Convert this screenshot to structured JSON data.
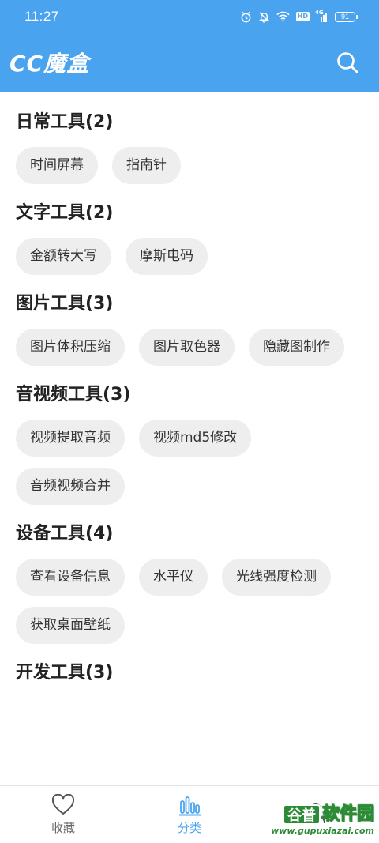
{
  "status_bar": {
    "time": "11:27",
    "network": "4G",
    "hd": "HD",
    "battery": "91"
  },
  "header": {
    "title": "CC魔盒",
    "search_icon": "search-icon"
  },
  "sections": [
    {
      "title": "日常工具(2)",
      "items": [
        "时间屏幕",
        "指南针"
      ]
    },
    {
      "title": "文字工具(2)",
      "items": [
        "金额转大写",
        "摩斯电码"
      ]
    },
    {
      "title": "图片工具(3)",
      "items": [
        "图片体积压缩",
        "图片取色器",
        "隐藏图制作"
      ]
    },
    {
      "title": "音视频工具(3)",
      "items": [
        "视频提取音频",
        "视频md5修改",
        "音频视频合并"
      ]
    },
    {
      "title": "设备工具(4)",
      "items": [
        "查看设备信息",
        "水平仪",
        "光线强度检测",
        "获取桌面壁纸"
      ]
    },
    {
      "title": "开发工具(3)",
      "items": []
    }
  ],
  "bottom_nav": {
    "items": [
      {
        "label": "收藏",
        "icon": "heart-icon"
      },
      {
        "label": "分类",
        "icon": "bar-chart-icon",
        "active": true
      },
      {
        "label": "",
        "icon": "person-icon"
      }
    ]
  },
  "watermark": {
    "badge": "谷普",
    "text": "软件园",
    "url": "www.gupuxiazai.com"
  },
  "colors": {
    "primary": "#4aa3ef",
    "chip_bg": "#eeeeee",
    "watermark_green": "#2d8a36"
  }
}
